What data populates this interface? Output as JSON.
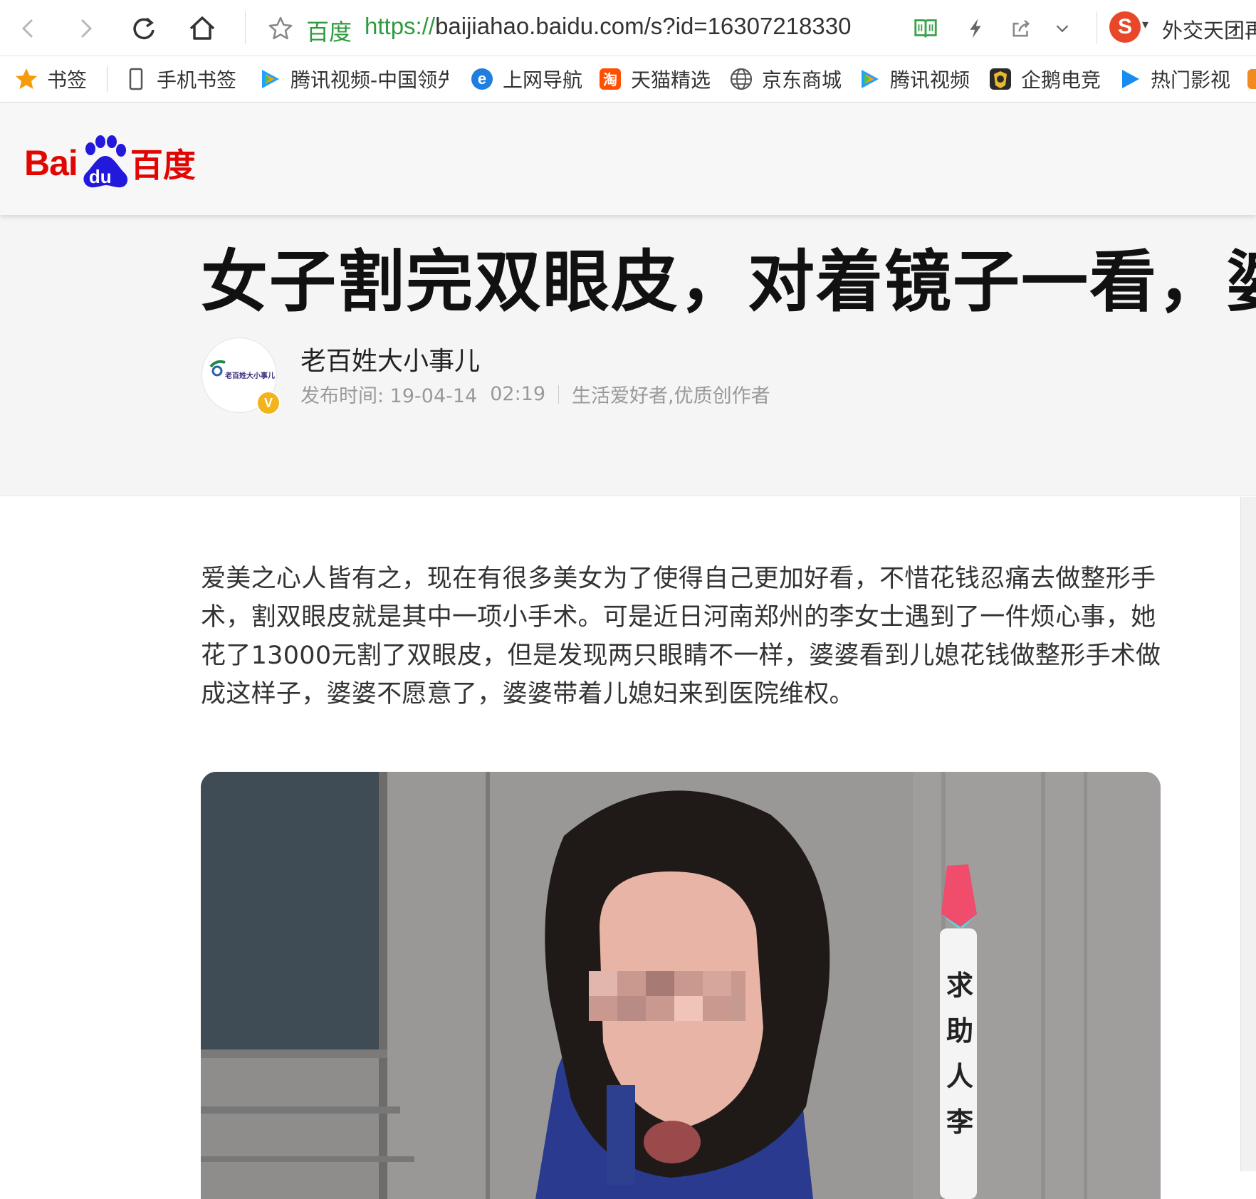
{
  "browser": {
    "site_name": "百度",
    "url_protocol": "https://",
    "url_rest": "baijiahao.baidu.com/s?id=16307218330",
    "search_text": "外交天团再",
    "icons": [
      "back-icon",
      "forward-icon",
      "reload-icon",
      "home-icon",
      "star-icon",
      "reader-icon",
      "lightning-icon",
      "share-icon",
      "chevron-down-icon",
      "sogou-icon"
    ]
  },
  "bookmarks": [
    {
      "label": "书签",
      "icon": "star-icon"
    },
    {
      "label": "手机书签",
      "icon": "phone-icon"
    },
    {
      "label": "腾讯视频-中国领先",
      "icon": "tencent-video-icon"
    },
    {
      "label": "上网导航",
      "icon": "ie-icon"
    },
    {
      "label": "天猫精选",
      "icon": "taobao-icon"
    },
    {
      "label": "京东商城",
      "icon": "globe-icon"
    },
    {
      "label": "腾讯视频",
      "icon": "tencent-video-icon"
    },
    {
      "label": "企鹅电竞",
      "icon": "penguin-esports-icon"
    },
    {
      "label": "热门影视",
      "icon": "play-icon"
    }
  ],
  "header": {
    "logo_latin": "Bai",
    "logo_du": "du",
    "logo_cn": "百度"
  },
  "article": {
    "title": "女子割完双眼皮，对着镜子一看，婆婆",
    "author": "老百姓大小事儿",
    "avatar_text": "老百姓大小事儿",
    "verified_badge": "V",
    "publish_label": "发布时间: 19-04-14",
    "publish_time": "02:19",
    "author_tags": "生活爱好者,优质创作者",
    "paragraph": "爱美之心人皆有之，现在有很多美女为了使得自己更加好看，不惜花钱忍痛去做整形手术，割双眼皮就是其中一项小手术。可是近日河南郑州的李女士遇到了一件烦心事，她花了13000元割了双眼皮，但是发现两只眼睛不一样，婆婆看到儿媳花钱做整形手术做成这样子，婆婆不愿意了，婆婆带着儿媳妇来到医院维权。",
    "image_caption_chars": [
      "求",
      "助",
      "人",
      "李"
    ]
  },
  "colors": {
    "baidu_red": "#e10602",
    "baidu_blue": "#2319dc",
    "url_green": "#2e9b3f"
  }
}
